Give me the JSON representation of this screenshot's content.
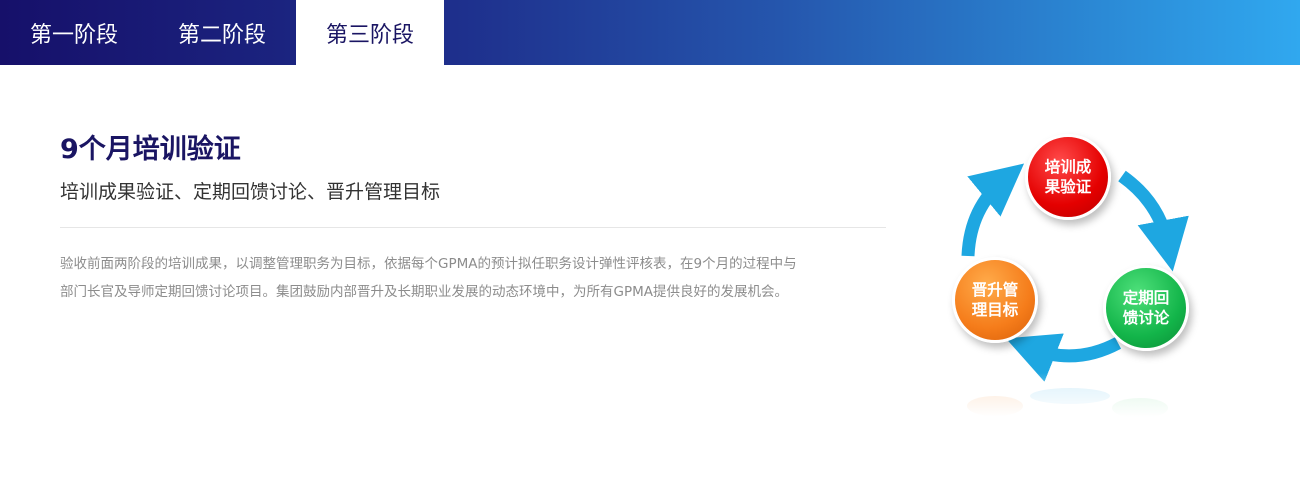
{
  "tabs": [
    {
      "label": "第一阶段"
    },
    {
      "label": "第二阶段"
    },
    {
      "label": "第三阶段"
    }
  ],
  "content": {
    "title": "9个月培训验证",
    "subtitle": "培训成果验证、定期回馈讨论、晋升管理目标",
    "description_line1": "验收前面两阶段的培训成果，以调整管理职务为目标，依据每个GPMA的预计拟任职务设计弹性评核表，在9个月的过程中与",
    "description_line2": "部门长官及导师定期回馈讨论项目。集团鼓励内部晋升及长期职业发展的动态环境中，为所有GPMA提供良好的发展机会。"
  },
  "diagram": {
    "nodes": [
      {
        "line1": "培训成",
        "line2": "果验证",
        "color": "#e40000"
      },
      {
        "line1": "定期回",
        "line2": "馈讨论",
        "color": "#13b54a"
      },
      {
        "line1": "晋升管",
        "line2": "理目标",
        "color": "#f57c1a"
      }
    ],
    "arrow_color": "#1ea7e1"
  }
}
